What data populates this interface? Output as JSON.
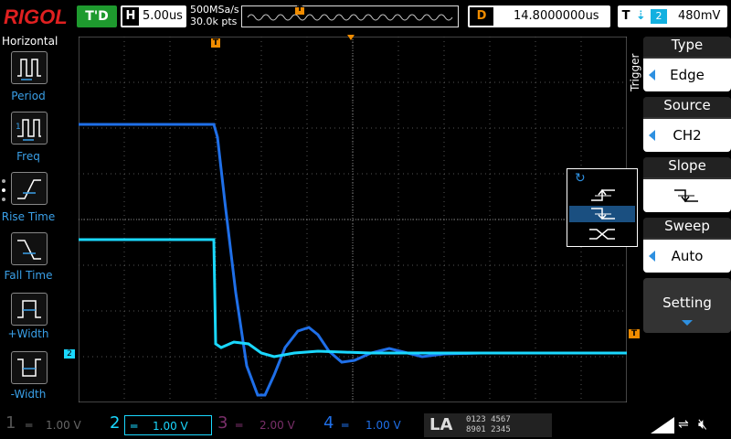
{
  "top": {
    "brand": "RIGOL",
    "run_status": "T'D",
    "horizontal_label": "H",
    "timebase": "5.00us",
    "sample_rate": "500MSa/s",
    "memory_depth": "30.0k pts",
    "delay_label": "D",
    "delay": "14.8000000us",
    "trigger_label": "T",
    "trigger_channel": "2",
    "trigger_level": "480mV"
  },
  "left_panel": {
    "title": "Horizontal",
    "items": [
      {
        "label": "Period"
      },
      {
        "label": "Freq"
      },
      {
        "label": "Rise Time"
      },
      {
        "label": "Fall Time"
      },
      {
        "label": "+Width"
      },
      {
        "label": "-Width"
      }
    ]
  },
  "trigger_menu": {
    "title": "Trigger",
    "type": {
      "head": "Type",
      "value": "Edge"
    },
    "source": {
      "head": "Source",
      "value": "CH2"
    },
    "slope": {
      "head": "Slope"
    },
    "sweep": {
      "head": "Sweep",
      "value": "Auto"
    },
    "setting": {
      "head": "Setting"
    }
  },
  "markers": {
    "trigger_pos": "T",
    "ch2_ground": "2",
    "trigger_level_marker": "T"
  },
  "channels": [
    {
      "num": "1",
      "scale": "1.00 V",
      "color": "#555555"
    },
    {
      "num": "2",
      "scale": "1.00 V",
      "color": "#1ad8ff"
    },
    {
      "num": "3",
      "scale": "2.00 V",
      "color": "#7a2f6a"
    },
    {
      "num": "4",
      "scale": "1.00 V",
      "color": "#1f6fe8"
    }
  ],
  "la": {
    "label": "LA",
    "row1": "0123 4567",
    "row2": "8901 2345"
  },
  "colors": {
    "ch2": "#1ad8ff",
    "ch4": "#1f6fe8",
    "accent_orange": "#f08c00",
    "brand_red": "#e02020",
    "run_green": "#1e9a2e"
  }
}
